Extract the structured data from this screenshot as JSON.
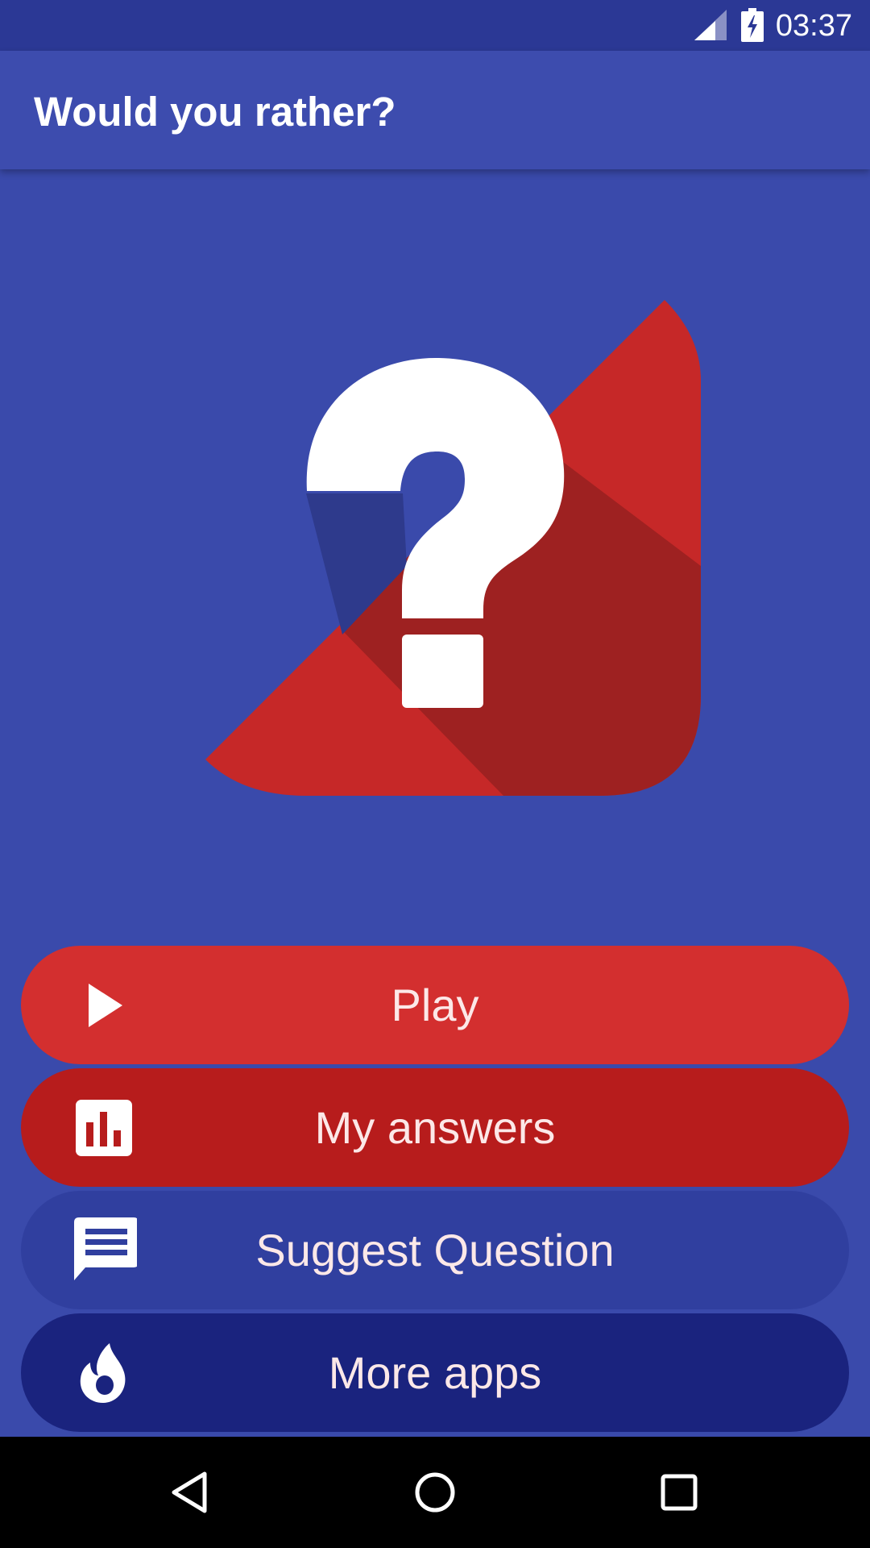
{
  "status_bar": {
    "time": "03:37",
    "icons": [
      "signal-icon",
      "battery-charging-icon"
    ]
  },
  "app_bar": {
    "title": "Would you rather?"
  },
  "logo": {
    "icon": "question-mark-logo",
    "colors": {
      "background": "#3a4aab",
      "red": "#c62828",
      "shadow_red": "#9e2121",
      "shadow_blue": "#2e3a8c",
      "glyph": "#ffffff"
    }
  },
  "menu": {
    "buttons": [
      {
        "label": "Play",
        "icon": "play-icon",
        "color": "#d32f2f"
      },
      {
        "label": "My answers",
        "icon": "bar-chart-icon",
        "color": "#b71c1c"
      },
      {
        "label": "Suggest Question",
        "icon": "message-icon",
        "color": "#303f9f"
      },
      {
        "label": "More apps",
        "icon": "flame-icon",
        "color": "#1a237e"
      }
    ]
  },
  "nav_bar": {
    "icons": [
      "back-icon",
      "home-icon",
      "recents-icon"
    ]
  }
}
